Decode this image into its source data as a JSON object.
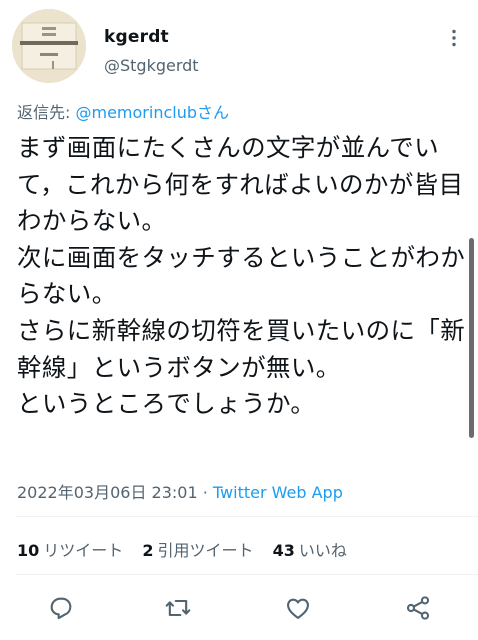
{
  "author": {
    "display_name": "kgerdt",
    "handle": "@Stgkgerdt"
  },
  "reply": {
    "prefix": "返信先: ",
    "mention": "@memorinclubさん"
  },
  "tweet": {
    "text": "まず画面にたくさんの文字が並んでいて，これから何をすればよいのかが皆目わからない。\n次に画面をタッチするということがわからない。\nさらに新幹線の切符を買いたいのに「新幹線」というボタンが無い。\nというところでしょうか。"
  },
  "meta": {
    "datetime": "2022年03月06日 23:01",
    "separator": " · ",
    "source": "Twitter Web App"
  },
  "stats": {
    "retweets": {
      "count": "10",
      "label": "リツイート"
    },
    "quotes": {
      "count": "2",
      "label": "引用ツイート"
    },
    "likes": {
      "count": "43",
      "label": "いいね"
    }
  },
  "icons": {
    "more": "more-icon",
    "reply": "reply-icon",
    "retweet": "retweet-icon",
    "like": "like-icon",
    "share": "share-icon"
  }
}
